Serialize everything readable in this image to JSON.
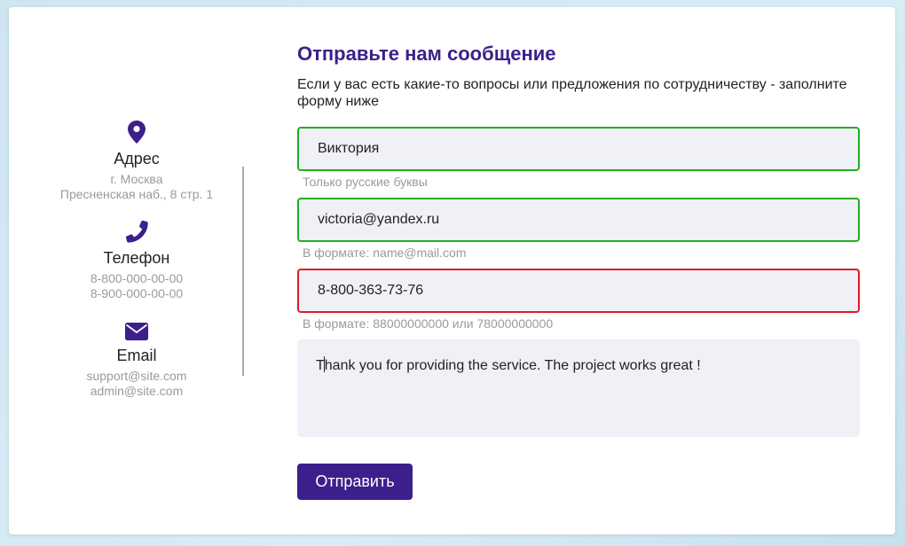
{
  "contacts": {
    "address": {
      "title": "Адрес",
      "lines": [
        "г. Москва",
        "Пресненская наб., 8 стр. 1"
      ]
    },
    "phone": {
      "title": "Телефон",
      "lines": [
        "8-800-000-00-00",
        "8-900-000-00-00"
      ]
    },
    "email": {
      "title": "Email",
      "lines": [
        "support@site.com",
        "admin@site.com"
      ]
    }
  },
  "form": {
    "title": "Отправьте нам сообщение",
    "description": "Если у вас есть какие-то вопросы или предложения по сотрудничеству - заполните форму ниже",
    "name_value": "Виктория",
    "name_hint": "Только русские буквы",
    "email_value": "victoria@yandex.ru",
    "email_hint": "В формате: name@mail.com",
    "phone_value": "8-800-363-73-76",
    "phone_hint": "В формате: 88000000000 или 78000000000",
    "message_first_char": "T",
    "message_rest": "hank you for providing the service. The project works great !",
    "submit_label": "Отправить"
  },
  "colors": {
    "accent": "#3d1f8c",
    "valid_border": "#22b022",
    "invalid_border": "#e01b24",
    "field_bg": "#f0f0f7",
    "muted_text": "#9a9a9a"
  },
  "icons": {
    "address": "map-marker-icon",
    "phone": "phone-icon",
    "email": "envelope-icon"
  }
}
